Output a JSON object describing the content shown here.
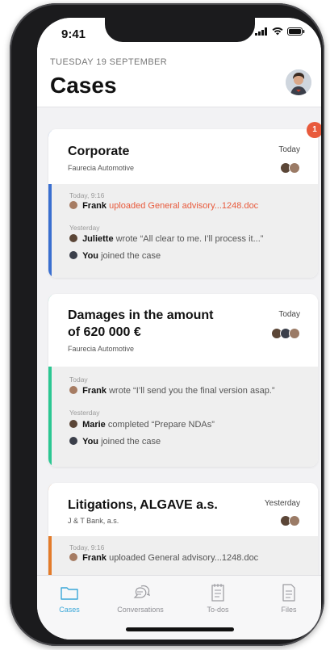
{
  "status": {
    "time": "9:41"
  },
  "header": {
    "date": "TUESDAY 19 SEPTEMBER",
    "title": "Cases"
  },
  "badge": {
    "count": "1"
  },
  "cases": [
    {
      "title": "Corporate",
      "company": "Faurecia Automotive",
      "date": "Today",
      "accent": "#3a6fd0",
      "groups": [
        {
          "label": "Today, 9:16",
          "items": [
            {
              "who": "Frank",
              "text": "uploaded General advisory...1248.doc"
            }
          ]
        },
        {
          "label": "Yesterday",
          "items": [
            {
              "who": "Juliette",
              "text": "wrote “All clear to me. I’ll process it...”"
            },
            {
              "who": "You",
              "text": "joined the case"
            }
          ]
        }
      ]
    },
    {
      "title": "Damages in the amount of 620 000 €",
      "company": "Faurecia Automotive",
      "date": "Today",
      "accent": "#2bc792",
      "groups": [
        {
          "label": "Today",
          "items": [
            {
              "who": "Frank",
              "text": "wrote “I’ll send you the final version asap.”"
            }
          ]
        },
        {
          "label": "Yesterday",
          "items": [
            {
              "who": "Marie",
              "text": "completed “Prepare NDAs”"
            },
            {
              "who": "You",
              "text": "joined the case"
            }
          ]
        }
      ]
    },
    {
      "title": "Litigations, ALGAVE a.s.",
      "company": "J & T Bank, a.s.",
      "date": "Yesterday",
      "accent": "#e37b2a",
      "groups": [
        {
          "label": "Today, 9:16",
          "items": [
            {
              "who": "Frank",
              "text": "uploaded General advisory...1248.doc"
            }
          ]
        }
      ]
    }
  ],
  "tabs": [
    {
      "label": "Cases",
      "icon": "folder-icon",
      "active": true
    },
    {
      "label": "Conversations",
      "icon": "chat-icon",
      "active": false
    },
    {
      "label": "To-dos",
      "icon": "notepad-icon",
      "active": false
    },
    {
      "label": "Files",
      "icon": "file-icon",
      "active": false
    }
  ],
  "colors": {
    "active_tab": "#3aa7d8",
    "highlight": "#e85a3c"
  }
}
